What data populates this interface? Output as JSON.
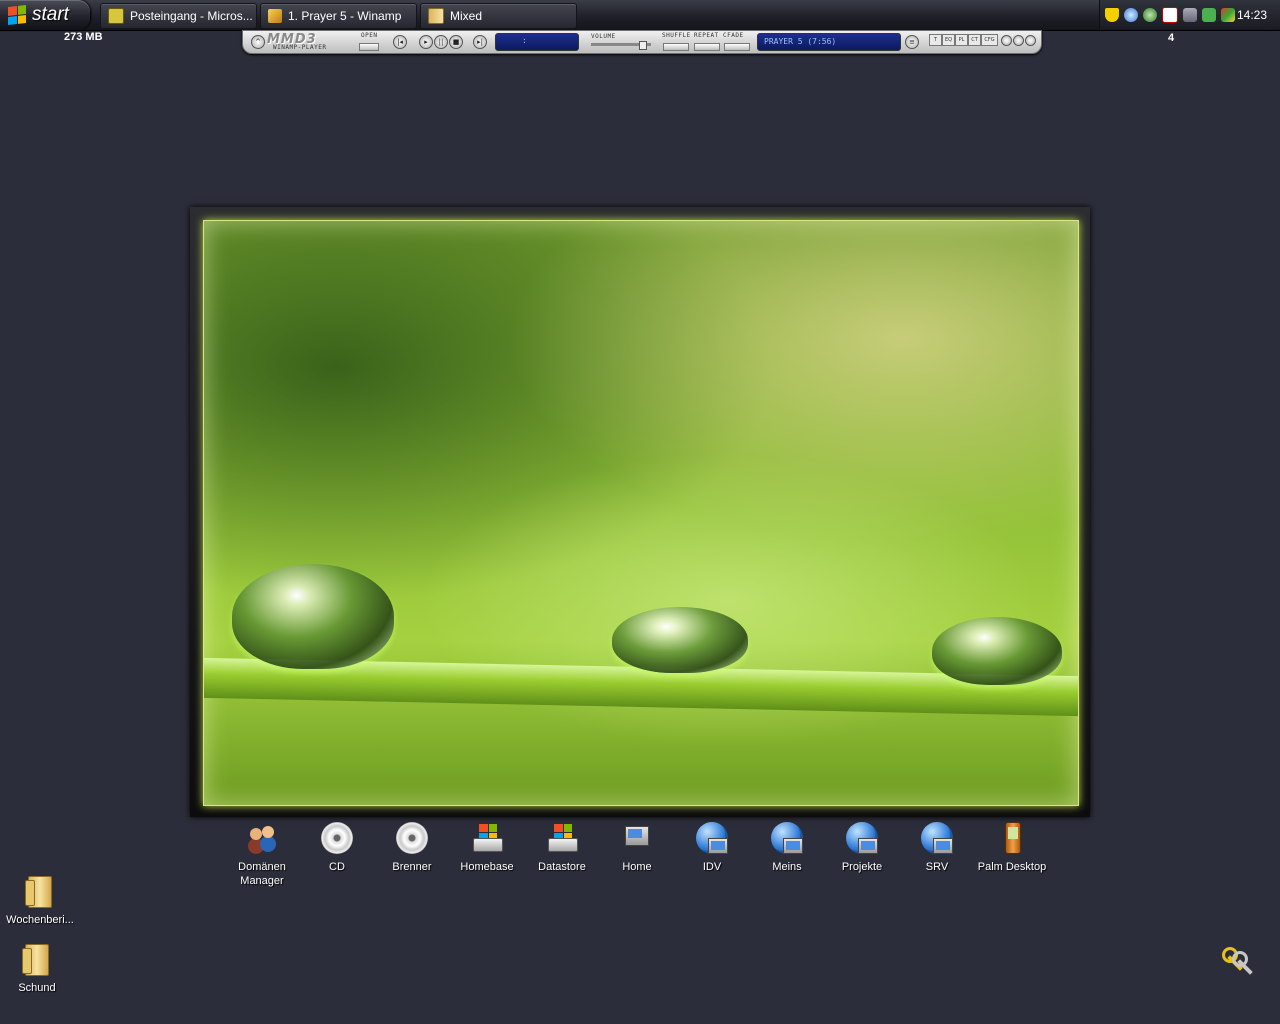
{
  "taskbar": {
    "start_label": "start",
    "tasks": [
      {
        "label": "Posteingang - Micros...",
        "icon": "outlook-icon"
      },
      {
        "label": "1. Prayer 5 - Winamp",
        "icon": "winamp-icon"
      },
      {
        "label": "Mixed",
        "icon": "folder-icon"
      }
    ],
    "clock": "14:23"
  },
  "memory_display": "273 MB",
  "virtual_desktop_number": "4",
  "winamp": {
    "skin_logo": "MMD3",
    "skin_sub": "WINAMP-PLAYER",
    "open_label": "OPEN",
    "time_display": ":",
    "volume_label": "VOLUME",
    "shuffle_label": "SHUFFLE",
    "repeat_label": "REPEAT",
    "crossfade_label": "CFADE",
    "track_title": "PRAYER 5 (7:56)",
    "buttons": [
      "T",
      "EQ",
      "PL",
      "CT",
      "CFG"
    ]
  },
  "dock": [
    {
      "label": "Domänen Manager",
      "icon": "users-icon"
    },
    {
      "label": "CD",
      "icon": "cd-icon"
    },
    {
      "label": "Brenner",
      "icon": "cd-burner-icon"
    },
    {
      "label": "Homebase",
      "icon": "windows-drive-icon"
    },
    {
      "label": "Datastore",
      "icon": "windows-drive-icon"
    },
    {
      "label": "Home",
      "icon": "computer-icon"
    },
    {
      "label": "IDV",
      "icon": "network-computer-icon"
    },
    {
      "label": "Meins",
      "icon": "network-computer-icon"
    },
    {
      "label": "Projekte",
      "icon": "network-computer-icon"
    },
    {
      "label": "SRV",
      "icon": "network-computer-icon"
    },
    {
      "label": "Palm Desktop",
      "icon": "palm-icon"
    }
  ],
  "desktop_icons": [
    {
      "label": "Wochenberi...",
      "icon": "folder-icon"
    },
    {
      "label": "Schund",
      "icon": "folder-icon"
    }
  ],
  "colors": {
    "desktop_bg": "#2b2d3a",
    "photo_border": "#d8e880",
    "winamp_display": "#1c2f8f"
  }
}
